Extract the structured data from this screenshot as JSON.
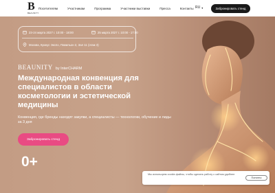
{
  "header": {
    "logo_letter": "B",
    "logo_sub": "BEAUNITY",
    "nav": [
      "Посетителям",
      "Участникам",
      "Программа",
      "Участники выставки",
      "Пресса",
      "Контакты"
    ],
    "lang": "RU",
    "book_label": "Забронировать стенд"
  },
  "event": {
    "dates_visitors": "23-24 марта 2027 г. 10:00 - 18:00",
    "dates_extra": "25 марта 2027 г. 10:00 - 17:00",
    "location": "Москва, Крокус Экспо, Павильон 2, Зал 11 (этаж 3)"
  },
  "hero": {
    "brand": "BEAUNITY",
    "brand_by": "by InterCHARM",
    "title": "Международная конвенция для специалистов в области косметологии и эстетической медицины",
    "subtitle": "Конвенция, где бренды находят закупки, а специалисты — технологии, обучение и лиды за 3 дня",
    "cta": "Забронировать стенд",
    "age_rating": "0+"
  },
  "cookie": {
    "text": "Мы используем cookie-файлы, чтобы сделать работу с сайтом удобнее",
    "button": "Понятно"
  },
  "colors": {
    "background": "#c9a48c",
    "accent_pink": "#e94b83",
    "dark": "#1a1a1a"
  }
}
